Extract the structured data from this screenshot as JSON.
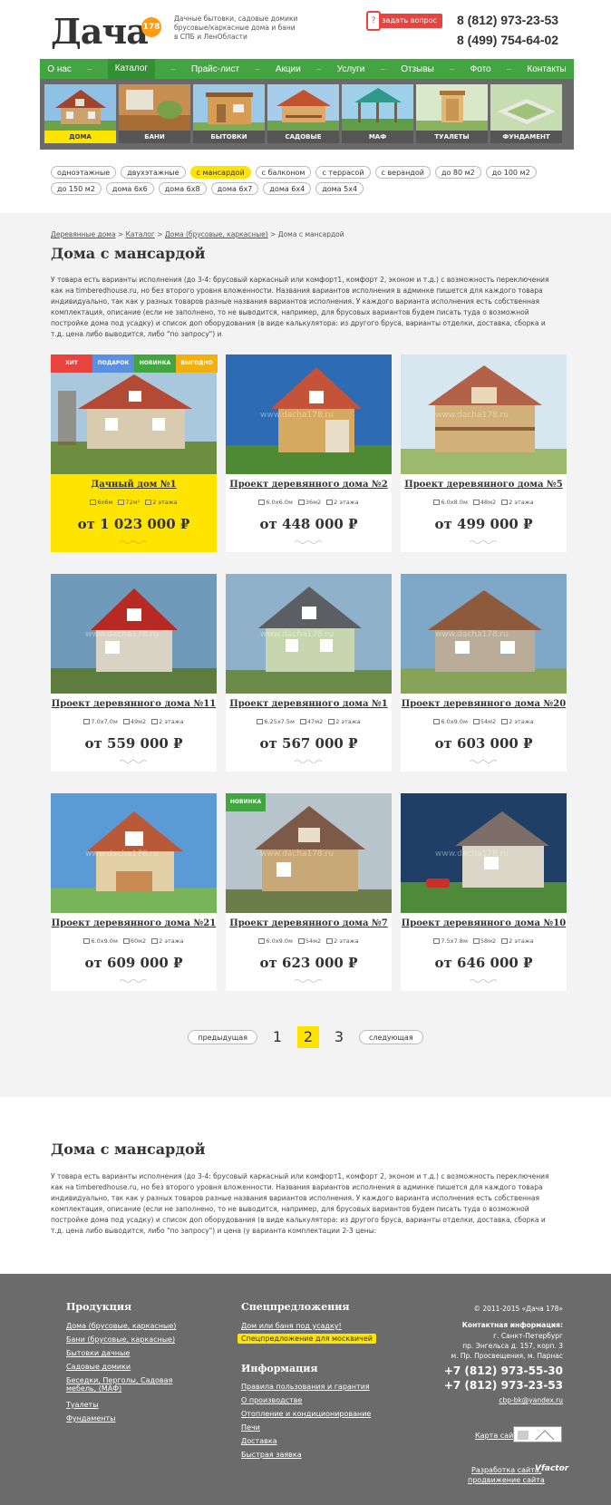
{
  "header": {
    "logo_text": "Дача",
    "logo_num": "178",
    "tagline": "Дачные бытовки, садовые домики брусовые/каркасные дома и бани в СПБ и ЛенОбласти",
    "ask_button": "задать вопрос",
    "phone1": "8 (812) 973-23-53",
    "phone2": "8 (499) 754-64-02"
  },
  "menu": [
    {
      "label": "О нас"
    },
    {
      "label": "Каталог"
    },
    {
      "label": "Прайс-лист"
    },
    {
      "label": "Акции"
    },
    {
      "label": "Услуги"
    },
    {
      "label": "Отзывы"
    },
    {
      "label": "Фото"
    },
    {
      "label": "Контакты"
    }
  ],
  "categories": [
    {
      "label": "ДОМА"
    },
    {
      "label": "БАНИ"
    },
    {
      "label": "БЫТОВКИ"
    },
    {
      "label": "САДОВЫЕ ДОМИКИ"
    },
    {
      "label": "МАФ"
    },
    {
      "label": "ТУАЛЕТЫ"
    },
    {
      "label": "ФУНДАМЕНТ"
    }
  ],
  "filters": [
    {
      "label": "одноэтажные"
    },
    {
      "label": "двухэтажные"
    },
    {
      "label": "с мансардой"
    },
    {
      "label": "с балконом"
    },
    {
      "label": "с террасой"
    },
    {
      "label": "с верандой"
    },
    {
      "label": "до 80 м2"
    },
    {
      "label": "до 100 м2"
    },
    {
      "label": "до 150 м2"
    },
    {
      "label": "дома 6х6"
    },
    {
      "label": "дома 6х8"
    },
    {
      "label": "дома 6х7"
    },
    {
      "label": "дома 6х4"
    },
    {
      "label": "дома 5х4"
    }
  ],
  "breadcrumb": {
    "b1": "Деревянные дома",
    "b2": "Каталог",
    "b3": "Дома (брусовые, каркасные)",
    "current": "Дома с мансардой"
  },
  "page_title": "Дома с мансардой",
  "intro": "У товара есть варианты исполнения (до 3-4: брусовый каркасный или комфорт1, комфорт 2, эконом и т.д.) с возможность переключения как на timberedhouse.ru, но без второго уровня вложенности. Названия вариантов исполнения в админке пишется для каждого товара индивидуально, так как у разных товаров разные названия вариантов исполнения. У каждого варианта исполнения есть собственная комплектация, описание (если не заполнено, то не выводится, например, для брусовых вариантов будем писать туда о возможной постройке дома под усадку) и список доп оборудования (в виде калькулятора: из другого бруса, варианты отделки, доставка, сборка и т.д. цена либо выводится, либо \"по запросу\") и",
  "badges": [
    "ХИТ",
    "ПОДАРОК",
    "НОВИНКА",
    "ВЫГОДНО"
  ],
  "badge_new": "НОВИНКА",
  "products": [
    {
      "title": "Дачный дом №1",
      "size": "6x6м",
      "area": "72м²",
      "floors": "2 этажа",
      "price": "от 1 023 000 ₽"
    },
    {
      "title": "Проект деревянного дома №2",
      "size": "6.0x6.0м",
      "area": "36м2",
      "floors": "2 этажа",
      "price": "от 448 000 ₽"
    },
    {
      "title": "Проект деревянного дома №5",
      "size": "6.0x8.0м",
      "area": "48м2",
      "floors": "2 этажа",
      "price": "от 499 000 ₽"
    },
    {
      "title": "Проект деревянного дома №11",
      "size": "7.0x7.0м",
      "area": "49м2",
      "floors": "2 этажа",
      "price": "от 559 000 ₽"
    },
    {
      "title": "Проект деревянного дома №1",
      "size": "6.25x7.5м",
      "area": "47м2",
      "floors": "2 этажа",
      "price": "от 567 000 ₽"
    },
    {
      "title": "Проект деревянного дома №20",
      "size": "6.0x9.0м",
      "area": "54м2",
      "floors": "2 этажа",
      "price": "от 603 000 ₽"
    },
    {
      "title": "Проект деревянного дома №21",
      "size": "6.0x9.0м",
      "area": "60м2",
      "floors": "2 этажа",
      "price": "от 609 000 ₽"
    },
    {
      "title": "Проект деревянного дома №7",
      "size": "6.0x9.0м",
      "area": "54м2",
      "floors": "2 этажа",
      "price": "от 623 000 ₽"
    },
    {
      "title": "Проект деревянного дома №10",
      "size": "7.5x7.8м",
      "area": "58м2",
      "floors": "2 этажа",
      "price": "от 646 000 ₽"
    }
  ],
  "watermark": "www.dacha178.ru",
  "pager": {
    "prev": "предыдущая",
    "p1": "1",
    "p2": "2",
    "p3": "3",
    "next": "следующая"
  },
  "seo": {
    "title": "Дома с мансардой",
    "text": "У товара есть варианты исполнения (до 3-4: брусовый каркасный или комфорт1, комфорт 2, эконом и т.д.) с возможность переключения как на timberedhouse.ru, но без второго уровня вложенности. Названия вариантов исполнения в админке пишется для каждого товара индивидуально, так как у разных товаров разные названия вариантов исполнения. У каждого варианта исполнения есть собственная комплектация, описание (если не заполнено, то не выводится, например, для брусовых вариантов будем писать туда о возможной постройке дома под усадку) и список доп оборудования (в виде калькулятора: из другого бруса, варианты отделки, доставка, сборка и т.д. цена либо выводится, либо \"по запросу\") и цена (у варианта комплектации 2-3 цены:"
  },
  "footer": {
    "products_title": "Продукция",
    "products": [
      "Дома (брусовые, каркасные)",
      "Бани (брусовые, каркасные)",
      "Бытовки дачные",
      "Садовые домики",
      "Беседки, Перголы, Садовая мебель, (МАФ)",
      "Туалеты",
      "Фундаменты"
    ],
    "special_title": "Спецпредложения",
    "special": [
      "Дом или баня под усадку!",
      "Спецпредложение для москвичей"
    ],
    "info_title": "Информация",
    "info": [
      "Правила пользования и гарантия",
      "О производстве",
      "Отопление и кондиционирование",
      "Печи",
      "Доставка",
      "Быстрая заявка"
    ],
    "copyright": "© 2011-2015 «Дача 178»",
    "contact_title": "Контактная информация:",
    "address1": "г. Санкт-Петербург",
    "address2": "пр. Энгельса д. 157, корп. 3",
    "address3": "м. Пр. Просвещения, м. Парнас",
    "phone1": "+7 (812) 973-55-30",
    "phone2": "+7 (812) 973-23-53",
    "email": "cbp-bk@yandex.ru",
    "sitemap": "Карта сайта",
    "dev1": "Разработка сайта,",
    "dev2": "продвижение сайта",
    "dev_brand": "Vfactor"
  },
  "colors": {
    "green": "#43a442",
    "yellow": "#ffe400",
    "red": "#e9433f",
    "orange": "#ff9b12",
    "footer_bg": "#6b6b6b"
  }
}
